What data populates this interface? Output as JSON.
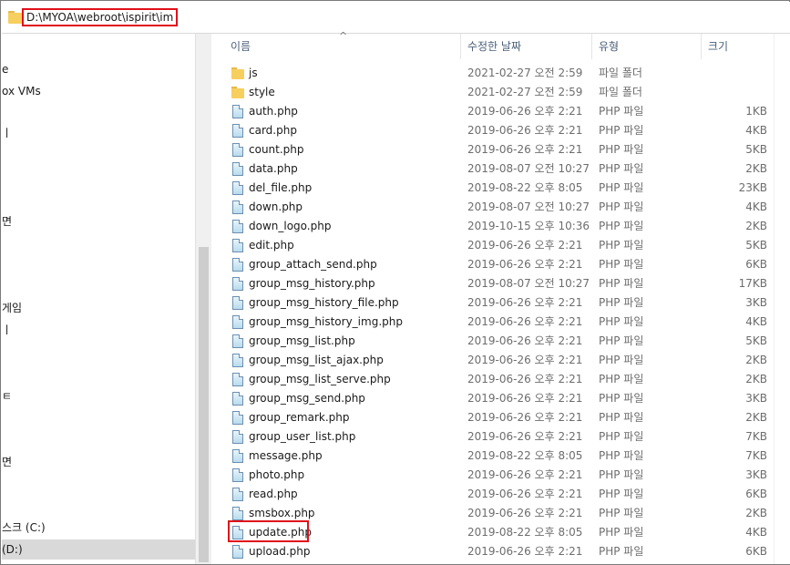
{
  "address": {
    "path": "D:\\MYOA\\webroot\\ispirit\\im"
  },
  "nav": {
    "items": [
      {
        "label": "e",
        "icon": ""
      },
      {
        "label": "ox VMs",
        "icon": ""
      },
      {
        "label": "ㅣ",
        "icon": ""
      },
      {
        "label": "면",
        "icon": ""
      },
      {
        "label": "게임",
        "icon": ""
      },
      {
        "label": "ㅣ",
        "icon": ""
      },
      {
        "label": "ㅌ",
        "icon": ""
      },
      {
        "label": "면",
        "icon": ""
      },
      {
        "label": "스크 (C:)",
        "icon": ""
      },
      {
        "label": "(D:)",
        "icon": ""
      }
    ]
  },
  "columns": {
    "name": "이름",
    "date": "수정한 날짜",
    "type": "유형",
    "size": "크기"
  },
  "files": [
    {
      "name": "js",
      "date": "2021-02-27 오전 2:59",
      "type": "파일 폴더",
      "size": "",
      "kind": "folder"
    },
    {
      "name": "style",
      "date": "2021-02-27 오전 2:59",
      "type": "파일 폴더",
      "size": "",
      "kind": "folder"
    },
    {
      "name": "auth.php",
      "date": "2019-06-26 오후 2:21",
      "type": "PHP 파일",
      "size": "1KB",
      "kind": "php"
    },
    {
      "name": "card.php",
      "date": "2019-06-26 오후 2:21",
      "type": "PHP 파일",
      "size": "4KB",
      "kind": "php"
    },
    {
      "name": "count.php",
      "date": "2019-06-26 오후 2:21",
      "type": "PHP 파일",
      "size": "5KB",
      "kind": "php"
    },
    {
      "name": "data.php",
      "date": "2019-08-07 오전 10:27",
      "type": "PHP 파일",
      "size": "2KB",
      "kind": "php"
    },
    {
      "name": "del_file.php",
      "date": "2019-08-22 오후 8:05",
      "type": "PHP 파일",
      "size": "23KB",
      "kind": "php"
    },
    {
      "name": "down.php",
      "date": "2019-08-07 오전 10:27",
      "type": "PHP 파일",
      "size": "4KB",
      "kind": "php"
    },
    {
      "name": "down_logo.php",
      "date": "2019-10-15 오후 10:36",
      "type": "PHP 파일",
      "size": "2KB",
      "kind": "php"
    },
    {
      "name": "edit.php",
      "date": "2019-06-26 오후 2:21",
      "type": "PHP 파일",
      "size": "5KB",
      "kind": "php"
    },
    {
      "name": "group_attach_send.php",
      "date": "2019-06-26 오후 2:21",
      "type": "PHP 파일",
      "size": "6KB",
      "kind": "php"
    },
    {
      "name": "group_msg_history.php",
      "date": "2019-08-07 오전 10:27",
      "type": "PHP 파일",
      "size": "17KB",
      "kind": "php"
    },
    {
      "name": "group_msg_history_file.php",
      "date": "2019-06-26 오후 2:21",
      "type": "PHP 파일",
      "size": "3KB",
      "kind": "php"
    },
    {
      "name": "group_msg_history_img.php",
      "date": "2019-06-26 오후 2:21",
      "type": "PHP 파일",
      "size": "4KB",
      "kind": "php"
    },
    {
      "name": "group_msg_list.php",
      "date": "2019-06-26 오후 2:21",
      "type": "PHP 파일",
      "size": "5KB",
      "kind": "php"
    },
    {
      "name": "group_msg_list_ajax.php",
      "date": "2019-06-26 오후 2:21",
      "type": "PHP 파일",
      "size": "2KB",
      "kind": "php"
    },
    {
      "name": "group_msg_list_serve.php",
      "date": "2019-06-26 오후 2:21",
      "type": "PHP 파일",
      "size": "2KB",
      "kind": "php"
    },
    {
      "name": "group_msg_send.php",
      "date": "2019-06-26 오후 2:21",
      "type": "PHP 파일",
      "size": "3KB",
      "kind": "php"
    },
    {
      "name": "group_remark.php",
      "date": "2019-06-26 오후 2:21",
      "type": "PHP 파일",
      "size": "2KB",
      "kind": "php"
    },
    {
      "name": "group_user_list.php",
      "date": "2019-06-26 오후 2:21",
      "type": "PHP 파일",
      "size": "7KB",
      "kind": "php"
    },
    {
      "name": "message.php",
      "date": "2019-08-22 오후 8:05",
      "type": "PHP 파일",
      "size": "7KB",
      "kind": "php"
    },
    {
      "name": "photo.php",
      "date": "2019-06-26 오후 2:21",
      "type": "PHP 파일",
      "size": "3KB",
      "kind": "php"
    },
    {
      "name": "read.php",
      "date": "2019-06-26 오후 2:21",
      "type": "PHP 파일",
      "size": "6KB",
      "kind": "php"
    },
    {
      "name": "smsbox.php",
      "date": "2019-06-26 오후 2:21",
      "type": "PHP 파일",
      "size": "2KB",
      "kind": "php"
    },
    {
      "name": "update.php",
      "date": "2019-08-22 오후 8:05",
      "type": "PHP 파일",
      "size": "4KB",
      "kind": "php",
      "highlighted": true
    },
    {
      "name": "upload.php",
      "date": "2019-06-26 오후 2:21",
      "type": "PHP 파일",
      "size": "6KB",
      "kind": "php"
    }
  ],
  "colors": {
    "highlight": "#e0101a",
    "folder": "#f7cf5f",
    "header_text": "#4c607a",
    "secondary_text": "#6d6d6d"
  },
  "icons": {
    "folder": "folder-icon",
    "php": "php-file-icon",
    "sort": "sort-up-icon"
  }
}
